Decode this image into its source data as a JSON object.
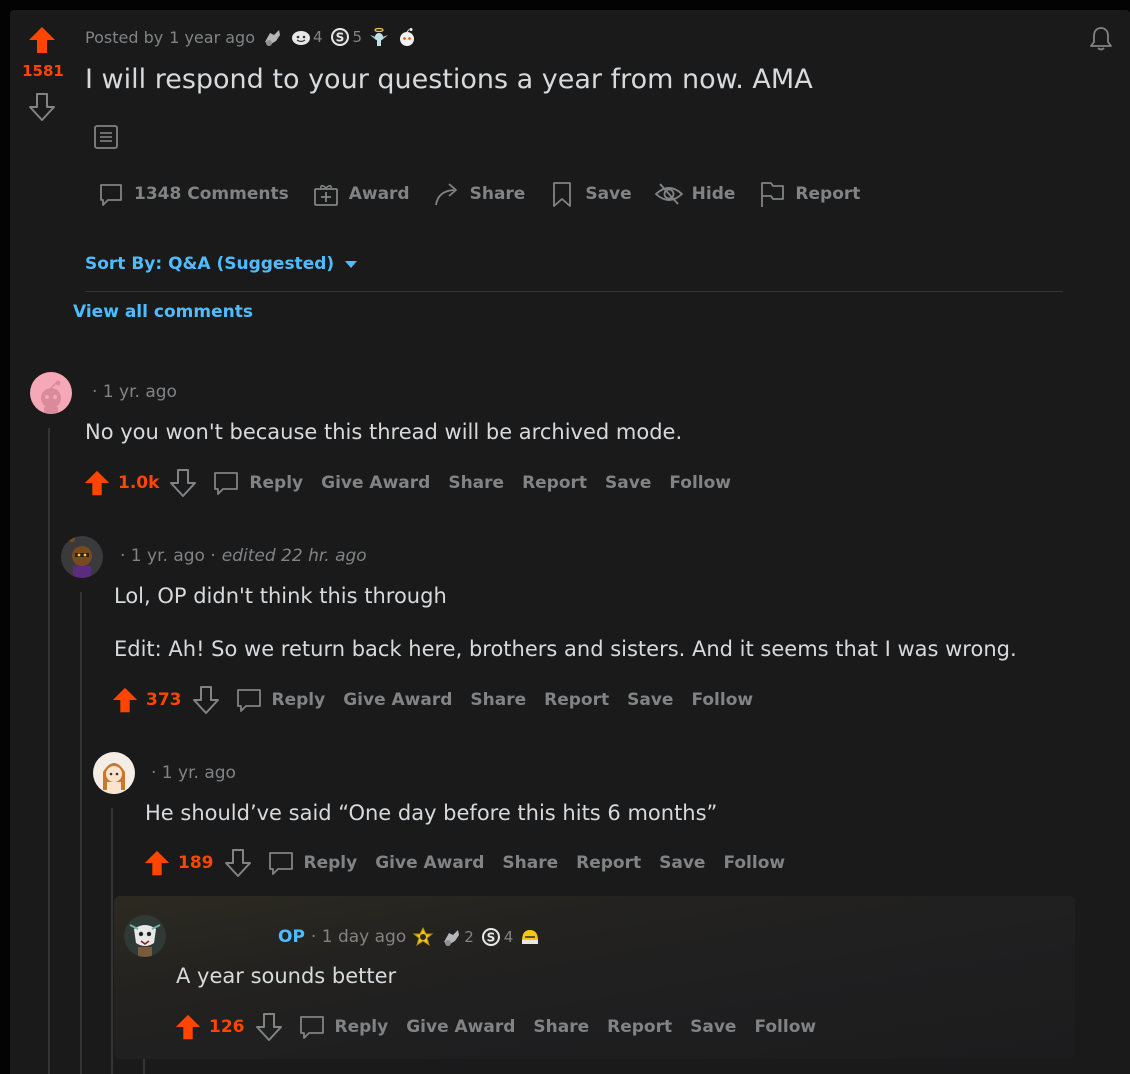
{
  "post": {
    "score": "1581",
    "posted_by": "Posted by",
    "time": "1 year ago",
    "awards": [
      {
        "icon": "silver-award-icon",
        "count": ""
      },
      {
        "icon": "wholesome-award-icon",
        "count": "4"
      },
      {
        "icon": "s-award-icon",
        "count": "5"
      },
      {
        "icon": "angel-award-icon",
        "count": ""
      },
      {
        "icon": "snoo-award-icon",
        "count": ""
      }
    ],
    "title": "I will respond to your questions a year from now. AMA",
    "actions": {
      "comments": "1348 Comments",
      "award": "Award",
      "share": "Share",
      "save": "Save",
      "hide": "Hide",
      "report": "Report"
    }
  },
  "sort": {
    "label": "Sort By: Q&A (Suggested)"
  },
  "view_all": "View all comments",
  "action_labels": {
    "reply": "Reply",
    "give_award": "Give Award",
    "share": "Share",
    "report": "Report",
    "save": "Save",
    "follow": "Follow"
  },
  "comments": [
    {
      "time": "· 1 yr. ago",
      "body": "No you won't because this thread will be archived mode.",
      "score": "1.0k"
    },
    {
      "time": "· 1 yr. ago ·",
      "edited": "edited 22 hr. ago",
      "body": "Lol, OP didn't think this through",
      "body2": "Edit: Ah! So we return back here, brothers and sisters. And it seems that I was wrong.",
      "score": "373"
    },
    {
      "time": "· 1 yr. ago",
      "body": "He should’ve said “One day before this hits 6 months”",
      "score": "189"
    },
    {
      "op": "OP",
      "time": "· 1 day ago",
      "awards": [
        {
          "icon": "gold-award-icon",
          "count": ""
        },
        {
          "icon": "silver-award-icon",
          "count": "2"
        },
        {
          "icon": "s-award-icon",
          "count": "4"
        },
        {
          "icon": "helmet-award-icon",
          "count": ""
        }
      ],
      "body": "A year sounds better",
      "score": "126"
    }
  ],
  "colors": {
    "upvote": "#ff4500",
    "link": "#4fbcff",
    "muted": "#818384",
    "text": "#d7dadc",
    "card": "#1a1a1b"
  }
}
